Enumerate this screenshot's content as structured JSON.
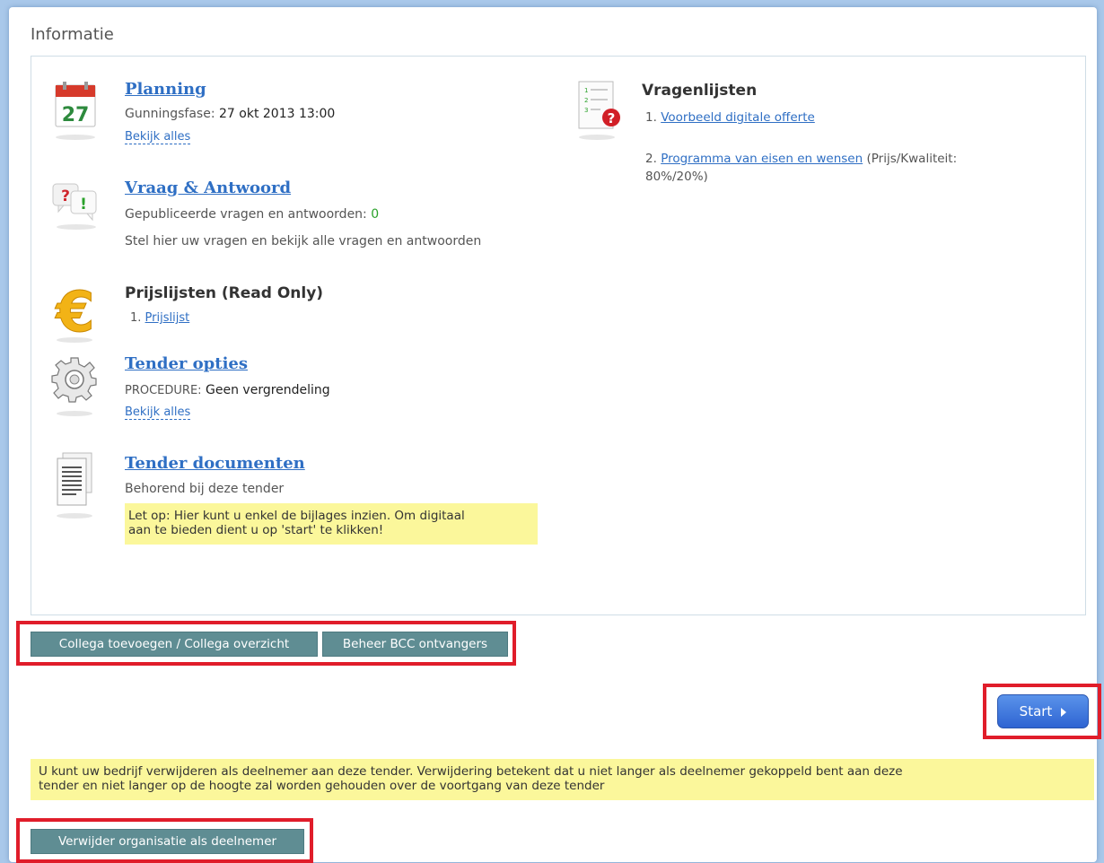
{
  "section_title": "Informatie",
  "planning": {
    "day": "27",
    "title": "Planning",
    "phase_label": "Gunningsfase:",
    "phase_value": "27 okt 2013 13:00",
    "view_all": "Bekijk alles"
  },
  "qa": {
    "title": "Vraag & Antwoord",
    "published_label": "Gepubliceerde vragen en antwoorden:",
    "published_count": "0",
    "description": "Stel hier uw vragen en bekijk alle vragen en antwoorden"
  },
  "pricelists": {
    "title": "Prijslijsten (Read Only)",
    "items": [
      {
        "num": "1.",
        "label": "Prijslijst"
      }
    ]
  },
  "tender_options": {
    "title": "Tender opties",
    "procedure_label": "PROCEDURE:",
    "procedure_value": "Geen vergrendeling",
    "view_all": "Bekijk alles"
  },
  "tender_docs": {
    "title": "Tender documenten",
    "subtitle": "Behorend bij deze tender",
    "note_line1": "Let op: Hier kunt u enkel de bijlages inzien. Om digitaal",
    "note_line2": "aan te bieden dient u op 'start' te klikken!"
  },
  "questionnaires": {
    "title": "Vragenlijsten",
    "items": [
      {
        "num": "1.",
        "label": "Voorbeeld digitale offerte",
        "suffix": ""
      },
      {
        "num": "2.",
        "label": "Programma van eisen en wensen",
        "suffix": "(Prijs/Kwaliteit:",
        "suffix2": "80%/20%)"
      }
    ]
  },
  "buttons": {
    "colleague": "Collega toevoegen / Collega overzicht",
    "bcc": "Beheer BCC ontvangers",
    "start": "Start",
    "remove": "Verwijder organisatie als deelnemer"
  },
  "bottom_note": {
    "line1": "U kunt uw bedrijf verwijderen als deelnemer aan deze tender. Verwijdering betekent dat u niet langer als deelnemer gekoppeld bent aan deze",
    "line2": "tender en niet langer op de hoogte zal worden gehouden over de voortgang van deze tender"
  },
  "colors": {
    "link": "#2f6fc4",
    "highlight": "#fbf79b",
    "button": "#5f8d93",
    "start_button": "#3a73dc",
    "callout_frame": "#e01d2a"
  }
}
